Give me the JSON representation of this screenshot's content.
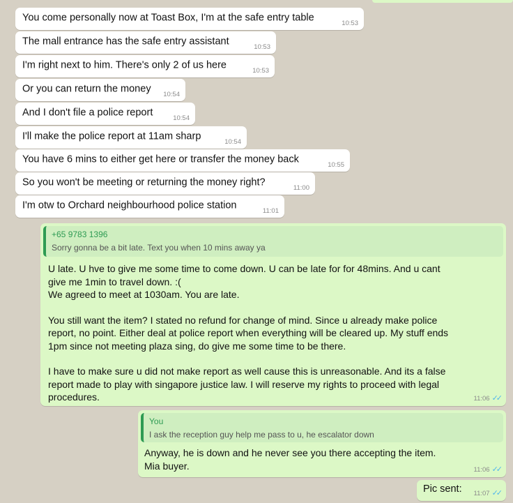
{
  "incoming_messages": [
    {
      "text": "You come personally now at Toast Box, I'm at the safe entry table",
      "time": "10:53"
    },
    {
      "text": "The mall entrance has the safe entry assistant",
      "time": "10:53"
    },
    {
      "text": "I'm right next to him. There's only 2 of us here",
      "time": "10:53"
    },
    {
      "text": "Or you can return the money",
      "time": "10:54"
    },
    {
      "text": "And I don't file a police report",
      "time": "10:54"
    },
    {
      "text": "I'll make the police report at 11am sharp",
      "time": "10:54"
    },
    {
      "text": "You have 6 mins to either get here or transfer the money back",
      "time": "10:55"
    },
    {
      "text": "So you won't be meeting or returning the money right?",
      "time": "11:00"
    },
    {
      "text": "I'm otw to Orchard neighbourhood police station",
      "time": "11:01"
    }
  ],
  "outgoing_reply_1": {
    "quote_author": "+65 9783 1396",
    "quote_text": "Sorry gonna be a bit late. Text you when 10 mins away ya",
    "lines": [
      "U late. U hve to give me some time to come down. U can be late for for 48mins. And u cant",
      "give me 1min to travel down. :(",
      "We agreed to meet at 1030am. You are late.",
      "You still want the item? I stated no refund for change of mind. Since u already make police",
      "report, no point. Either deal at police report when everything will be cleared up. My stuff ends",
      "1pm since not meeting plaza sing, do give me some time to be there.",
      "I have to make sure u did not make report as well cause this is unreasonable. And its a false",
      "report made to play with singapore justice law. I will reserve my rights to proceed with legal",
      "procedures."
    ],
    "time": "11:06"
  },
  "outgoing_reply_2": {
    "quote_author": "You",
    "quote_text": "I ask the reception guy help me pass to u, he escalator down",
    "lines": [
      "Anyway, he is down and he never see you there accepting the item.",
      "Mia buyer."
    ],
    "time": "11:06"
  },
  "outgoing_pic": {
    "text": "Pic sent:",
    "time": "11:07"
  },
  "read_ticks": "✓✓",
  "colors": {
    "incoming": "#ffffff",
    "outgoing": "#dcf8c6",
    "quote_accent": "#2e9b53",
    "ticks": "#4fb6ec"
  }
}
